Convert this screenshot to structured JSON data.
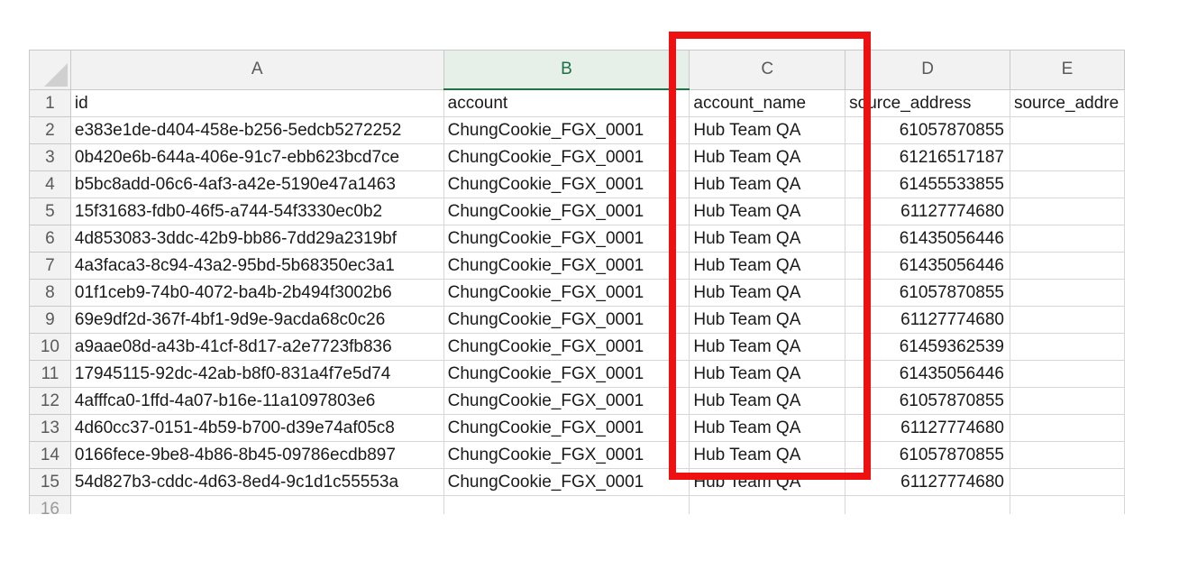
{
  "spreadsheet": {
    "column_letters": [
      "A",
      "B",
      "C",
      "D",
      "E"
    ],
    "active_column": "B",
    "rows": [
      {
        "n": "1",
        "a": "id",
        "b": "account",
        "c": "account_name",
        "d": "source_address",
        "e": "source_addre"
      },
      {
        "n": "2",
        "a": "e383e1de-d404-458e-b256-5edcb5272252",
        "b": "ChungCookie_FGX_0001",
        "c": "Hub Team QA",
        "d": "61057870855",
        "e": ""
      },
      {
        "n": "3",
        "a": "0b420e6b-644a-406e-91c7-ebb623bcd7ce",
        "b": "ChungCookie_FGX_0001",
        "c": "Hub Team QA",
        "d": "61216517187",
        "e": ""
      },
      {
        "n": "4",
        "a": "b5bc8add-06c6-4af3-a42e-5190e47a1463",
        "b": "ChungCookie_FGX_0001",
        "c": "Hub Team QA",
        "d": "61455533855",
        "e": ""
      },
      {
        "n": "5",
        "a": "15f31683-fdb0-46f5-a744-54f3330ec0b2",
        "b": "ChungCookie_FGX_0001",
        "c": "Hub Team QA",
        "d": "61127774680",
        "e": ""
      },
      {
        "n": "6",
        "a": "4d853083-3ddc-42b9-bb86-7dd29a2319bf",
        "b": "ChungCookie_FGX_0001",
        "c": "Hub Team QA",
        "d": "61435056446",
        "e": ""
      },
      {
        "n": "7",
        "a": "4a3faca3-8c94-43a2-95bd-5b68350ec3a1",
        "b": "ChungCookie_FGX_0001",
        "c": "Hub Team QA",
        "d": "61435056446",
        "e": ""
      },
      {
        "n": "8",
        "a": "01f1ceb9-74b0-4072-ba4b-2b494f3002b6",
        "b": "ChungCookie_FGX_0001",
        "c": "Hub Team QA",
        "d": "61057870855",
        "e": ""
      },
      {
        "n": "9",
        "a": "69e9df2d-367f-4bf1-9d9e-9acda68c0c26",
        "b": "ChungCookie_FGX_0001",
        "c": "Hub Team QA",
        "d": "61127774680",
        "e": ""
      },
      {
        "n": "10",
        "a": "a9aae08d-a43b-41cf-8d17-a2e7723fb836",
        "b": "ChungCookie_FGX_0001",
        "c": "Hub Team QA",
        "d": "61459362539",
        "e": ""
      },
      {
        "n": "11",
        "a": "17945115-92dc-42ab-b8f0-831a4f7e5d74",
        "b": "ChungCookie_FGX_0001",
        "c": "Hub Team QA",
        "d": "61435056446",
        "e": ""
      },
      {
        "n": "12",
        "a": "4afffca0-1ffd-4a07-b16e-11a1097803e6",
        "b": "ChungCookie_FGX_0001",
        "c": "Hub Team QA",
        "d": "61057870855",
        "e": ""
      },
      {
        "n": "13",
        "a": "4d60cc37-0151-4b59-b700-d39e74af05c8",
        "b": "ChungCookie_FGX_0001",
        "c": "Hub Team QA",
        "d": "61127774680",
        "e": ""
      },
      {
        "n": "14",
        "a": "0166fece-9be8-4b86-8b45-09786ecdb897",
        "b": "ChungCookie_FGX_0001",
        "c": "Hub Team QA",
        "d": "61057870855",
        "e": ""
      },
      {
        "n": "15",
        "a": "54d827b3-cddc-4d63-8ed4-9c1d1c55553a",
        "b": "ChungCookie_FGX_0001",
        "c": "Hub Team QA",
        "d": "61127774680",
        "e": ""
      },
      {
        "n": "16",
        "a": "",
        "b": "",
        "c": "",
        "d": "",
        "e": ""
      }
    ]
  },
  "annotation": {
    "highlight_color": "#ee1111",
    "highlighted_column": "C"
  }
}
